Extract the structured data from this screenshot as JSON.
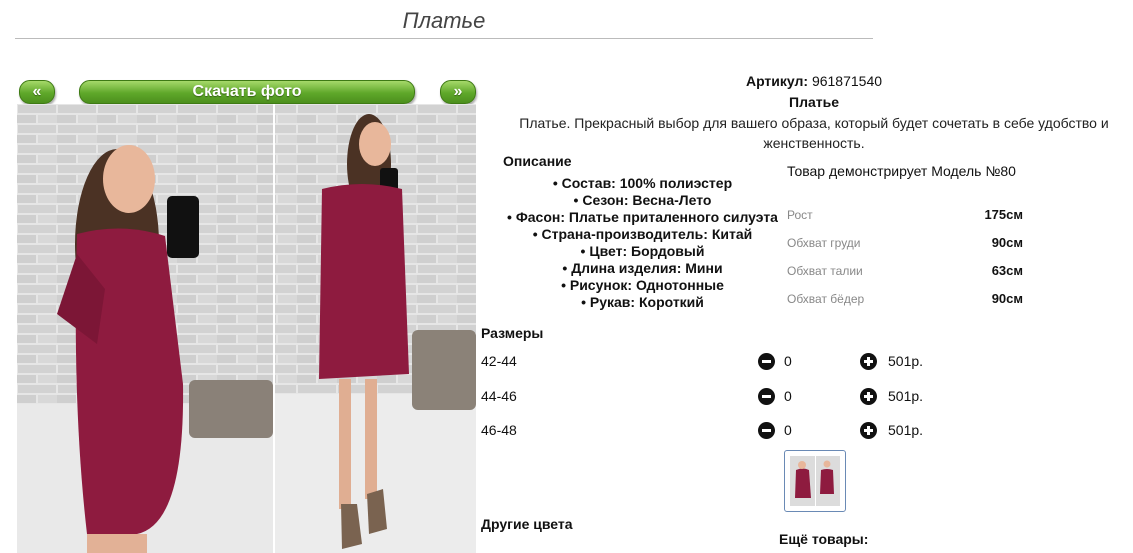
{
  "page": {
    "title": "Платье"
  },
  "gallery": {
    "prev_label": "«",
    "download_label": "Скачать фото",
    "next_label": "»"
  },
  "product": {
    "sku_label": "Артикул:",
    "sku_value": "961871540",
    "name": "Платье",
    "description": "Платье. Прекрасный выбор для вашего образа, который будет сочетать в себе удобство и женственность.",
    "desc_heading": "Описание",
    "specs": [
      "Состав: 100% полиэстер",
      "Сезон: Весна-Лето",
      "Фасон: Платье приталенного силуэта",
      "Страна-производитель: Китай",
      "Цвет: Бордовый",
      "Длина изделия: Мини",
      "Рисунок: Однотонные",
      "Рукав: Короткий"
    ]
  },
  "model": {
    "title": "Товар демонстрирует Модель №80",
    "measurements": [
      {
        "label": "Рост",
        "value": "175см"
      },
      {
        "label": "Обхват груди",
        "value": "90см"
      },
      {
        "label": "Обхват талии",
        "value": "63см"
      },
      {
        "label": "Обхват бёдер",
        "value": "90см"
      }
    ]
  },
  "sizes": {
    "heading": "Размеры",
    "rows": [
      {
        "size": "42-44",
        "qty": "0",
        "price": "501р."
      },
      {
        "size": "44-46",
        "qty": "0",
        "price": "501р."
      },
      {
        "size": "46-48",
        "qty": "0",
        "price": "501р."
      }
    ]
  },
  "footer": {
    "other_colors": "Другие цвета",
    "more_goods": "Ещё товары:"
  },
  "colors": {
    "button_green": "#5fa82a",
    "dress_burgundy": "#8e1b3f",
    "thumb_border": "#6a8ab5"
  }
}
